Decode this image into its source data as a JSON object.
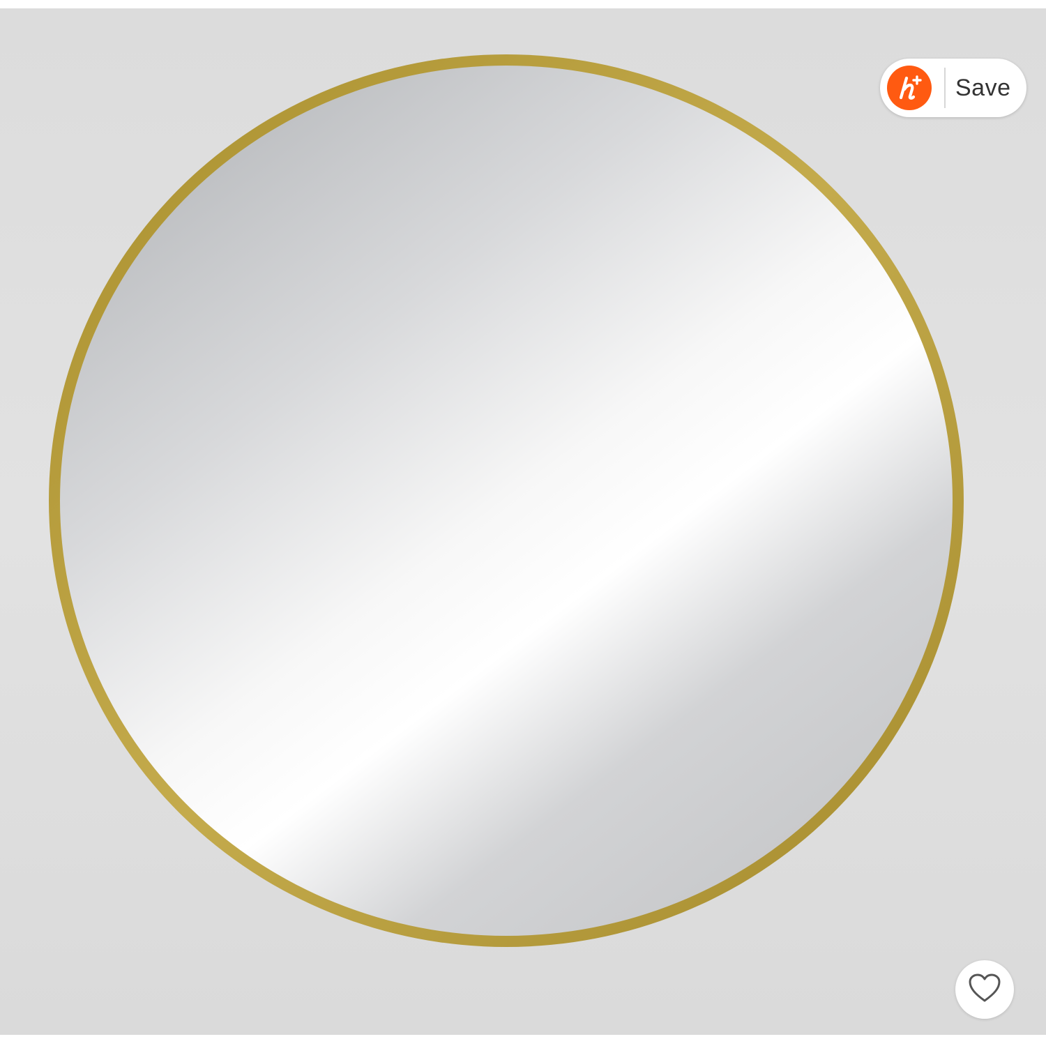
{
  "save_widget": {
    "logo_icon": "houzz-h-plus-icon",
    "logo_color": "#ff5a11",
    "label": "Save"
  },
  "favorite": {
    "icon": "heart-outline-icon"
  },
  "product_image": {
    "subject": "round-mirror-icon",
    "frame_color": "#b89e3c"
  }
}
